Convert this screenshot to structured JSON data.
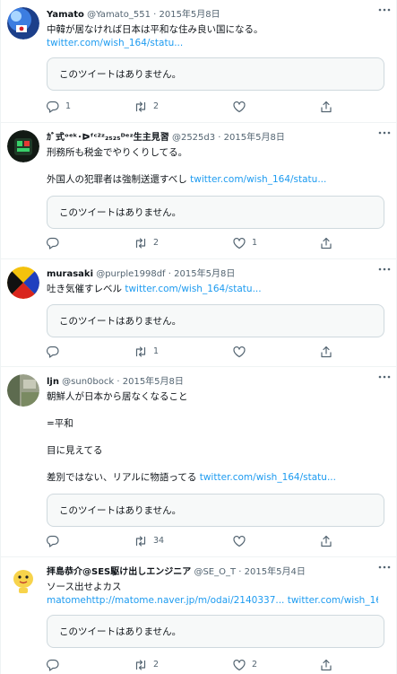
{
  "no_tweet_text": "このツイートはありません。",
  "icons": {
    "reply": "reply-icon",
    "retweet": "retweet-icon",
    "like": "heart-icon",
    "share": "share-icon",
    "more": "more-icon"
  },
  "colors": {
    "link": "#1d9bf0",
    "meta": "#536471",
    "divider": "#eff3f4"
  },
  "tweets": [
    {
      "name": "Yamato",
      "handle": "@Yamato_551",
      "date": "2015年5月8日",
      "lines": [
        {
          "text": "中韓が居なければ日本は平和な住み良い国になる。",
          "link": ""
        },
        {
          "text": "",
          "link": "twitter.com/wish_164/statu..."
        }
      ],
      "reply_count": "1",
      "retweet_count": "2",
      "like_count": ""
    },
    {
      "name": "ｶﾞ式ᵒᵉᵏ･ᐅᶠᶜ²ᶻ₂₅₂₅ᴰᵉᶻ生主見習",
      "handle": "@2525d3",
      "date": "2015年5月8日",
      "lines": [
        {
          "text": "刑務所も税金でやりくりしてる。",
          "link": ""
        },
        {
          "text": "",
          "link": ""
        },
        {
          "text": "外国人の犯罪者は強制送還すべし ",
          "link": "twitter.com/wish_164/statu..."
        }
      ],
      "reply_count": "",
      "retweet_count": "2",
      "like_count": "1"
    },
    {
      "name": "murasaki",
      "handle": "@purple1998df",
      "date": "2015年5月8日",
      "lines": [
        {
          "text": "吐き気催すレベル ",
          "link": "twitter.com/wish_164/statu..."
        }
      ],
      "reply_count": "",
      "retweet_count": "1",
      "like_count": ""
    },
    {
      "name": "ljn",
      "handle": "@sun0bock",
      "date": "2015年5月8日",
      "lines": [
        {
          "text": "朝鮮人が日本から居なくなること",
          "link": ""
        },
        {
          "text": "",
          "link": ""
        },
        {
          "text": "=平和",
          "link": ""
        },
        {
          "text": "",
          "link": ""
        },
        {
          "text": "目に見えてる",
          "link": ""
        },
        {
          "text": "",
          "link": ""
        },
        {
          "text": "差別ではない、リアルに物語ってる ",
          "link": "twitter.com/wish_164/statu..."
        }
      ],
      "reply_count": "",
      "retweet_count": "34",
      "like_count": ""
    },
    {
      "name": "拝島恭介@SES駆け出しエンジニア",
      "handle": "@SE_O_T",
      "date": "2015年5月4日",
      "lines": [
        {
          "text": "ソース出せよカス",
          "link": ""
        },
        {
          "text": "",
          "link": "matomehttp://matome.naver.jp/m/odai/2140337... twitter.com/wish_164/statu..."
        }
      ],
      "reply_count": "",
      "retweet_count": "2",
      "like_count": "2"
    }
  ]
}
